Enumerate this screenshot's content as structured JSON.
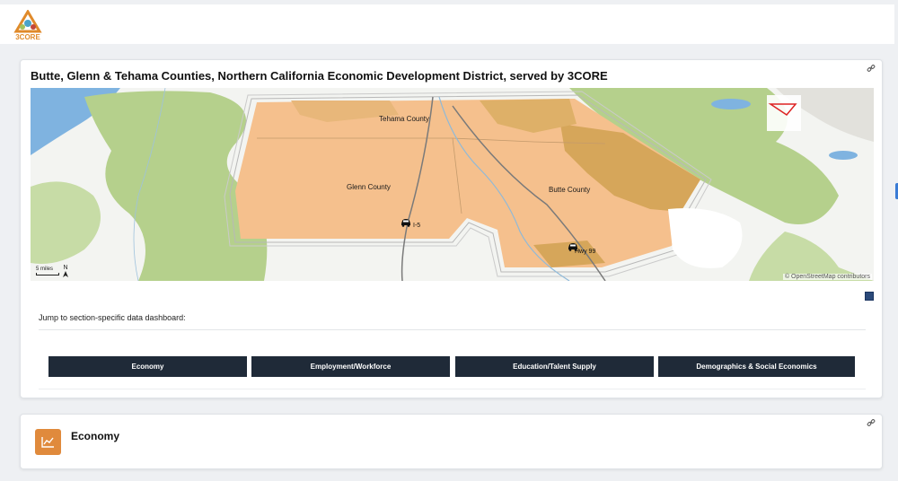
{
  "header": {
    "logo_text": "3CORE",
    "colors": {
      "logo_orange": "#e08a2a"
    }
  },
  "map_card": {
    "title": "Butte, Glenn & Tehama Counties, Northern California Economic Development District, served by 3CORE",
    "map": {
      "labels": {
        "tehama": "Tehama County",
        "glenn": "Glenn County",
        "butte": "Butte County",
        "i5": "I-5",
        "hwy99": "Hwy 99"
      },
      "attribution": "© OpenStreetMap contributors",
      "scale_label": "5 miles",
      "north_label": "N"
    },
    "jump_label": "Jump to section-specific data dashboard:",
    "buttons": {
      "economy": "Economy",
      "employment": "Employment/Workforce",
      "education": "Education/Talent Supply",
      "demographics": "Demographics & Social Economics"
    }
  },
  "economy_card": {
    "title": "Economy"
  }
}
